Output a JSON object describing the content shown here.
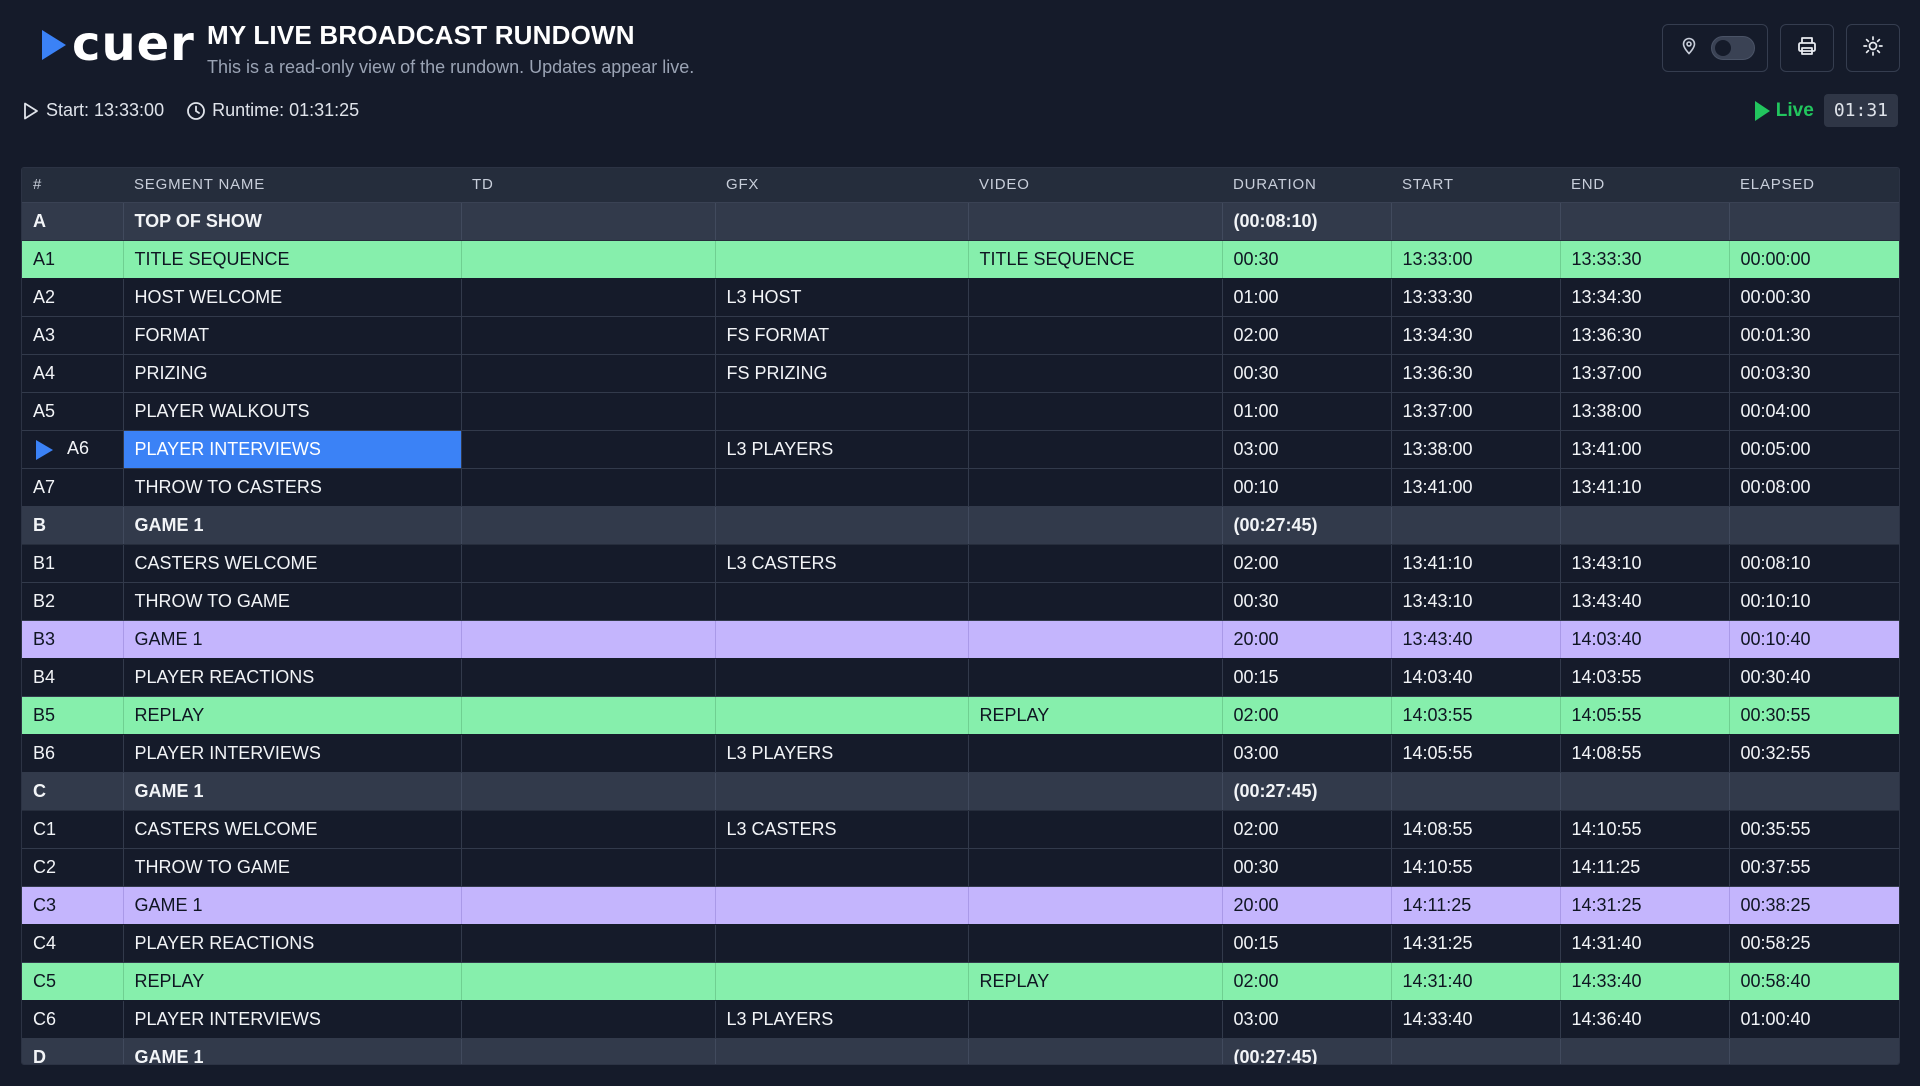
{
  "header": {
    "logo_text": "cuer",
    "title": "MY LIVE BROADCAST RUNDOWN",
    "subtitle": "This is a read-only view of the rundown. Updates appear live."
  },
  "controls": {
    "pin_icon": "map-pin-icon",
    "toggle_state": "off",
    "print_icon": "printer-icon",
    "theme_icon": "sun-icon"
  },
  "info": {
    "start": "Start: 13:33:00",
    "runtime": "Runtime: 01:31:25"
  },
  "live": {
    "label": "Live",
    "timer": "01:31",
    "color": "#22c55e"
  },
  "colors": {
    "accent": "#3b82f6",
    "green_row": "#86efac",
    "purple_row": "#c4b5fd",
    "background": "#151b2a"
  },
  "table": {
    "columns": [
      "#",
      "SEGMENT NAME",
      "TD",
      "GFX",
      "VIDEO",
      "DURATION",
      "START",
      "END",
      "ELAPSED"
    ],
    "rows": [
      {
        "type": "section",
        "num": "A",
        "name": "TOP OF SHOW",
        "td": "",
        "gfx": "",
        "video": "",
        "duration": "(00:08:10)",
        "start": "",
        "end": "",
        "elapsed": ""
      },
      {
        "type": "green",
        "num": "A1",
        "name": "TITLE SEQUENCE",
        "td": "",
        "gfx": "",
        "video": "TITLE SEQUENCE",
        "duration": "00:30",
        "start": "13:33:00",
        "end": "13:33:30",
        "elapsed": "00:00:00"
      },
      {
        "type": "normal",
        "num": "A2",
        "name": "HOST WELCOME",
        "td": "",
        "gfx": "L3 HOST",
        "video": "",
        "duration": "01:00",
        "start": "13:33:30",
        "end": "13:34:30",
        "elapsed": "00:00:30"
      },
      {
        "type": "normal",
        "num": "A3",
        "name": "FORMAT",
        "td": "",
        "gfx": "FS FORMAT",
        "video": "",
        "duration": "02:00",
        "start": "13:34:30",
        "end": "13:36:30",
        "elapsed": "00:01:30"
      },
      {
        "type": "normal",
        "num": "A4",
        "name": "PRIZING",
        "td": "",
        "gfx": "FS PRIZING",
        "video": "",
        "duration": "00:30",
        "start": "13:36:30",
        "end": "13:37:00",
        "elapsed": "00:03:30"
      },
      {
        "type": "normal",
        "num": "A5",
        "name": "PLAYER WALKOUTS",
        "td": "",
        "gfx": "",
        "video": "",
        "duration": "01:00",
        "start": "13:37:00",
        "end": "13:38:00",
        "elapsed": "00:04:00"
      },
      {
        "type": "current",
        "num": "A6",
        "name": "PLAYER INTERVIEWS",
        "td": "",
        "gfx": "L3 PLAYERS",
        "video": "",
        "duration": "03:00",
        "start": "13:38:00",
        "end": "13:41:00",
        "elapsed": "00:05:00"
      },
      {
        "type": "normal",
        "num": "A7",
        "name": "THROW TO CASTERS",
        "td": "",
        "gfx": "",
        "video": "",
        "duration": "00:10",
        "start": "13:41:00",
        "end": "13:41:10",
        "elapsed": "00:08:00"
      },
      {
        "type": "section",
        "num": "B",
        "name": "GAME 1",
        "td": "",
        "gfx": "",
        "video": "",
        "duration": "(00:27:45)",
        "start": "",
        "end": "",
        "elapsed": ""
      },
      {
        "type": "normal",
        "num": "B1",
        "name": "CASTERS WELCOME",
        "td": "",
        "gfx": "L3 CASTERS",
        "video": "",
        "duration": "02:00",
        "start": "13:41:10",
        "end": "13:43:10",
        "elapsed": "00:08:10"
      },
      {
        "type": "normal",
        "num": "B2",
        "name": "THROW TO GAME",
        "td": "",
        "gfx": "",
        "video": "",
        "duration": "00:30",
        "start": "13:43:10",
        "end": "13:43:40",
        "elapsed": "00:10:10"
      },
      {
        "type": "purple",
        "num": "B3",
        "name": "GAME 1",
        "td": "",
        "gfx": "",
        "video": "",
        "duration": "20:00",
        "start": "13:43:40",
        "end": "14:03:40",
        "elapsed": "00:10:40"
      },
      {
        "type": "normal",
        "num": "B4",
        "name": "PLAYER REACTIONS",
        "td": "",
        "gfx": "",
        "video": "",
        "duration": "00:15",
        "start": "14:03:40",
        "end": "14:03:55",
        "elapsed": "00:30:40"
      },
      {
        "type": "green",
        "num": "B5",
        "name": "REPLAY",
        "td": "",
        "gfx": "",
        "video": "REPLAY",
        "duration": "02:00",
        "start": "14:03:55",
        "end": "14:05:55",
        "elapsed": "00:30:55"
      },
      {
        "type": "normal",
        "num": "B6",
        "name": "PLAYER INTERVIEWS",
        "td": "",
        "gfx": "L3 PLAYERS",
        "video": "",
        "duration": "03:00",
        "start": "14:05:55",
        "end": "14:08:55",
        "elapsed": "00:32:55"
      },
      {
        "type": "section",
        "num": "C",
        "name": "GAME 1",
        "td": "",
        "gfx": "",
        "video": "",
        "duration": "(00:27:45)",
        "start": "",
        "end": "",
        "elapsed": ""
      },
      {
        "type": "normal",
        "num": "C1",
        "name": "CASTERS WELCOME",
        "td": "",
        "gfx": "L3 CASTERS",
        "video": "",
        "duration": "02:00",
        "start": "14:08:55",
        "end": "14:10:55",
        "elapsed": "00:35:55"
      },
      {
        "type": "normal",
        "num": "C2",
        "name": "THROW TO GAME",
        "td": "",
        "gfx": "",
        "video": "",
        "duration": "00:30",
        "start": "14:10:55",
        "end": "14:11:25",
        "elapsed": "00:37:55"
      },
      {
        "type": "purple",
        "num": "C3",
        "name": "GAME 1",
        "td": "",
        "gfx": "",
        "video": "",
        "duration": "20:00",
        "start": "14:11:25",
        "end": "14:31:25",
        "elapsed": "00:38:25"
      },
      {
        "type": "normal",
        "num": "C4",
        "name": "PLAYER REACTIONS",
        "td": "",
        "gfx": "",
        "video": "",
        "duration": "00:15",
        "start": "14:31:25",
        "end": "14:31:40",
        "elapsed": "00:58:25"
      },
      {
        "type": "green",
        "num": "C5",
        "name": "REPLAY",
        "td": "",
        "gfx": "",
        "video": "REPLAY",
        "duration": "02:00",
        "start": "14:31:40",
        "end": "14:33:40",
        "elapsed": "00:58:40"
      },
      {
        "type": "normal",
        "num": "C6",
        "name": "PLAYER INTERVIEWS",
        "td": "",
        "gfx": "L3 PLAYERS",
        "video": "",
        "duration": "03:00",
        "start": "14:33:40",
        "end": "14:36:40",
        "elapsed": "01:00:40"
      },
      {
        "type": "section",
        "num": "D",
        "name": "GAME 1",
        "td": "",
        "gfx": "",
        "video": "",
        "duration": "(00:27:45)",
        "start": "",
        "end": "",
        "elapsed": ""
      }
    ]
  }
}
